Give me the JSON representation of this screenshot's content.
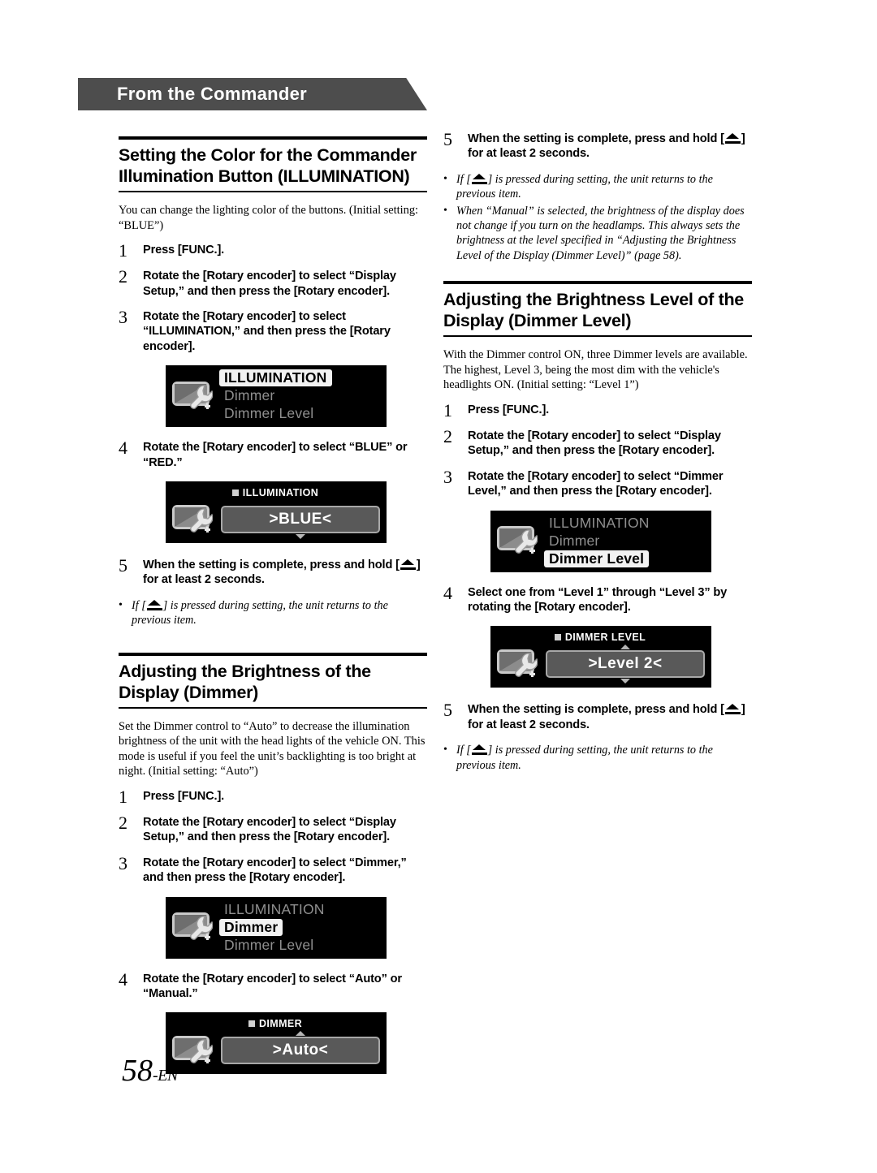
{
  "banner": {
    "label": "From the Commander"
  },
  "page": {
    "number": "58",
    "suffix": "-EN"
  },
  "icons": {
    "setup": "display-setup-wrench-icon",
    "back": "return-back-icon",
    "chevron_up": "chevron-up-icon",
    "chevron_down": "chevron-down-icon"
  },
  "sections": {
    "illumination": {
      "heading": "Setting the Color for the Commander Illumination Button (ILLUMINATION)",
      "intro": "You can change the lighting color of the buttons. (Initial setting: “BLUE”)",
      "steps": [
        {
          "num": "1",
          "text": "Press [FUNC.]."
        },
        {
          "num": "2",
          "text": "Rotate the [Rotary encoder] to select “Display Setup,” and then press the [Rotary encoder]."
        },
        {
          "num": "3",
          "text": "Rotate the [Rotary encoder] to select “ILLUMINATION,” and then press the [Rotary encoder]."
        },
        {
          "num": "4",
          "text": "Rotate the [Rotary encoder] to select “BLUE” or “RED.”"
        }
      ],
      "step5_pre": "When the setting is complete, press and hold [",
      "step5_post": "] for at least 2 seconds.",
      "step5_num": "5",
      "note_pre": "If [",
      "note_post": "] is pressed during setting, the unit returns to the previous item.",
      "lcd_menu": {
        "rows": [
          "ILLUMINATION",
          "Dimmer",
          "Dimmer Level"
        ],
        "selected_index": 0
      },
      "lcd_value": {
        "title": "ILLUMINATION",
        "value": ">BLUE<",
        "chevron_up": false,
        "chevron_down": true
      }
    },
    "dimmer": {
      "heading": "Adjusting the Brightness of the Display (Dimmer)",
      "intro": "Set the Dimmer control to “Auto” to decrease the illumination brightness of the unit with the head lights of the vehicle ON. This mode is useful if you feel the unit’s backlighting is too bright at night. (Initial setting: “Auto”)",
      "steps": [
        {
          "num": "1",
          "text": "Press [FUNC.]."
        },
        {
          "num": "2",
          "text": "Rotate the [Rotary encoder] to select “Display Setup,” and then press the [Rotary encoder]."
        },
        {
          "num": "3",
          "text": "Rotate the [Rotary encoder] to select “Dimmer,” and then press the [Rotary encoder]."
        },
        {
          "num": "4",
          "text": "Rotate the [Rotary encoder] to select “Auto” or “Manual.”"
        }
      ],
      "lcd_menu": {
        "rows": [
          "ILLUMINATION",
          "Dimmer",
          "Dimmer Level"
        ],
        "selected_index": 1
      },
      "lcd_value": {
        "title": "DIMMER",
        "value": ">Auto<",
        "chevron_up": true,
        "chevron_down": false
      }
    },
    "dimmer_level": {
      "heading": "Adjusting the Brightness Level of the Display (Dimmer Level)",
      "intro": "With the Dimmer control ON, three Dimmer levels are available. The highest, Level 3, being the most dim with the vehicle's headlights ON. (Initial setting: “Level 1”)",
      "steps": [
        {
          "num": "1",
          "text": "Press [FUNC.]."
        },
        {
          "num": "2",
          "text": "Rotate the [Rotary encoder] to select “Display Setup,” and then press the [Rotary encoder]."
        },
        {
          "num": "3",
          "text": "Rotate the [Rotary encoder] to select “Dimmer Level,” and then press the [Rotary encoder]."
        },
        {
          "num": "4",
          "text": "Select one from “Level 1” through “Level 3” by rotating the [Rotary encoder]."
        }
      ],
      "step5_num": "5",
      "step5_pre": "When the setting is complete, press and hold [",
      "step5_post": "] for at least 2 seconds.",
      "note_pre": "If [",
      "note_post": "] is pressed during setting, the unit returns to the previous item.",
      "lcd_menu": {
        "rows": [
          "ILLUMINATION",
          "Dimmer",
          "Dimmer Level"
        ],
        "selected_index": 2
      },
      "lcd_value": {
        "title": "DIMMER LEVEL",
        "value": ">Level 2<",
        "chevron_up": true,
        "chevron_down": true
      }
    },
    "top_right": {
      "step5_num": "5",
      "step5_pre": "When the setting is complete, press and hold [",
      "step5_post": "] for at least 2 seconds.",
      "note1_pre": "If [",
      "note1_post": "] is pressed during setting, the unit returns to the previous item.",
      "note2": "When “Manual” is selected, the brightness of the display does not change if you turn on the headlamps. This always sets the brightness at the level specified in “Adjusting the Brightness Level of the Display (Dimmer Level)” (page 58)."
    }
  }
}
